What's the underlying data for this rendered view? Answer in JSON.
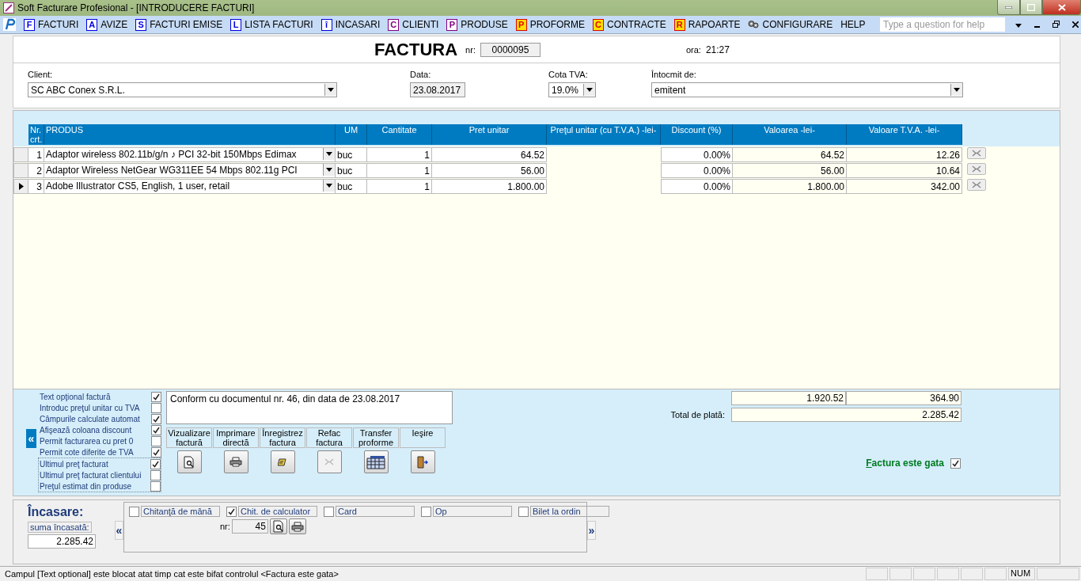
{
  "window": {
    "title": "Soft Facturare Profesional - [INTRODUCERE FACTURI]"
  },
  "menu": [
    {
      "label": "FACTURI",
      "letter": "F",
      "kind": "plain",
      "color": "#0000e0"
    },
    {
      "label": "AVIZE",
      "letter": "A",
      "kind": "plain",
      "color": "#0000e0"
    },
    {
      "label": "FACTURI EMISE",
      "letter": "S",
      "kind": "plain",
      "color": "#0000e0"
    },
    {
      "label": "LISTA FACTURI",
      "letter": "L",
      "kind": "plain",
      "color": "#0000e0"
    },
    {
      "label": "INCASARI",
      "letter": "î",
      "kind": "plain",
      "color": "#0000e0"
    },
    {
      "label": "CLIENTI",
      "letter": "C",
      "kind": "plain",
      "color": "#800080"
    },
    {
      "label": "PRODUSE",
      "letter": "P",
      "kind": "plain",
      "color": "#800080"
    },
    {
      "label": "PROFORME",
      "letter": "P",
      "kind": "highlight",
      "color": "#e00000"
    },
    {
      "label": "CONTRACTE",
      "letter": "C",
      "kind": "highlight",
      "color": "#e00000"
    },
    {
      "label": "RAPOARTE",
      "letter": "R",
      "kind": "highlight",
      "color": "#e00000"
    },
    {
      "label": "CONFIGURARE",
      "kind": "gear"
    },
    {
      "label": "HELP",
      "kind": "none"
    }
  ],
  "help_search": {
    "placeholder": "Type a question for help"
  },
  "header": {
    "title": "FACTURA",
    "nr_label": "nr:",
    "nr": "0000095",
    "time_label": "ora:",
    "time": "21:27"
  },
  "fields": [
    {
      "label": "Client:",
      "value": "SC ABC Conex S.R.L.",
      "dropdown": true
    },
    {
      "label": "Data:",
      "value": "23.08.2017",
      "dropdown": false
    },
    {
      "label": "Cota TVA:",
      "value": "19.0%",
      "dropdown": true
    },
    {
      "label": "Întocmit de:",
      "value": "emitent",
      "dropdown": true
    }
  ],
  "table": {
    "columns": [
      "Nr. crt.",
      "PRODUS",
      "UM",
      "Cantitate",
      "Pret unitar",
      "Preţul unitar (cu T.V.A.) -lei-",
      "Discount (%)",
      "Valoarea -lei-",
      "Valoare T.V.A. -lei-"
    ],
    "rows": [
      {
        "nr": "1",
        "product": "Adaptor wireless 802.11b/g/n ♪ PCI 32-bit 150Mbps Edimax",
        "um": "buc",
        "qty": "1",
        "price": "64.52",
        "discount": "0.00%",
        "value": "64.52",
        "vat": "12.26",
        "selected": false
      },
      {
        "nr": "2",
        "product": "Adaptor Wireless NetGear WG311EE 54 Mbps 802.11g PCI",
        "um": "buc",
        "qty": "1",
        "price": "56.00",
        "discount": "0.00%",
        "value": "56.00",
        "vat": "10.64",
        "selected": false
      },
      {
        "nr": "3",
        "product": "Adobe Illustrator CS5, English, 1 user, retail",
        "um": "buc",
        "qty": "1",
        "price": "1.800.00",
        "discount": "0.00%",
        "value": "1.800.00",
        "vat": "342.00",
        "selected": true
      }
    ]
  },
  "options": [
    {
      "label": "Text opţional factură",
      "checked": true
    },
    {
      "label": "Introduc preţul unitar cu TVA",
      "checked": false
    },
    {
      "label": "Câmpurile calculate automat",
      "checked": true
    },
    {
      "label": "Afişează coloana discount",
      "checked": true
    },
    {
      "label": "Permit facturarea cu pret 0",
      "checked": false
    },
    {
      "label": "Permit cote diferite de TVA",
      "checked": true
    }
  ],
  "price_options": [
    {
      "label": "Ultimul preţ facturat",
      "checked": true
    },
    {
      "label": "Ultimul preţ facturat clientului",
      "checked": false
    },
    {
      "label": "Preţul estimat din produse",
      "checked": false
    }
  ],
  "collapse_button": "«",
  "note": "Conform cu documentul nr. 46, din data de 23.08.2017",
  "actions": [
    {
      "label": "Vizualizare factură",
      "kind": "preview",
      "disabled": false
    },
    {
      "label": "Imprimare directă",
      "kind": "print",
      "disabled": false
    },
    {
      "label": "Înregistrez factura",
      "kind": "save",
      "disabled": false
    },
    {
      "label": "Refac factura",
      "kind": "undo",
      "disabled": true
    },
    {
      "label": "Transfer proforme",
      "kind": "grid",
      "disabled": false
    },
    {
      "label": "Ieşire",
      "kind": "exit",
      "disabled": false
    }
  ],
  "totals": {
    "value": "1.920.52",
    "vat": "364.90",
    "total_label": "Total de plată:",
    "total": "2.285.42"
  },
  "ready": {
    "label": "Factura este gata",
    "checked": true
  },
  "payment": {
    "title": "Încasare:",
    "amount_label": "suma încasată:",
    "amount": "2.285.42",
    "prev": "«",
    "next": "»",
    "types": [
      {
        "label": "Chitanţă de mână",
        "checked": false
      },
      {
        "label": "Chit. de calculator",
        "checked": true
      },
      {
        "label": "Card",
        "checked": false
      },
      {
        "label": "Op",
        "checked": false
      },
      {
        "label": "Bilet la ordin",
        "checked": false
      }
    ],
    "nr_label": "nr:",
    "nr": "45"
  },
  "status_bar": {
    "message": "Campul [Text optional] este blocat atat timp cat este bifat controlul <Factura este gata>",
    "indicator": "NUM"
  }
}
